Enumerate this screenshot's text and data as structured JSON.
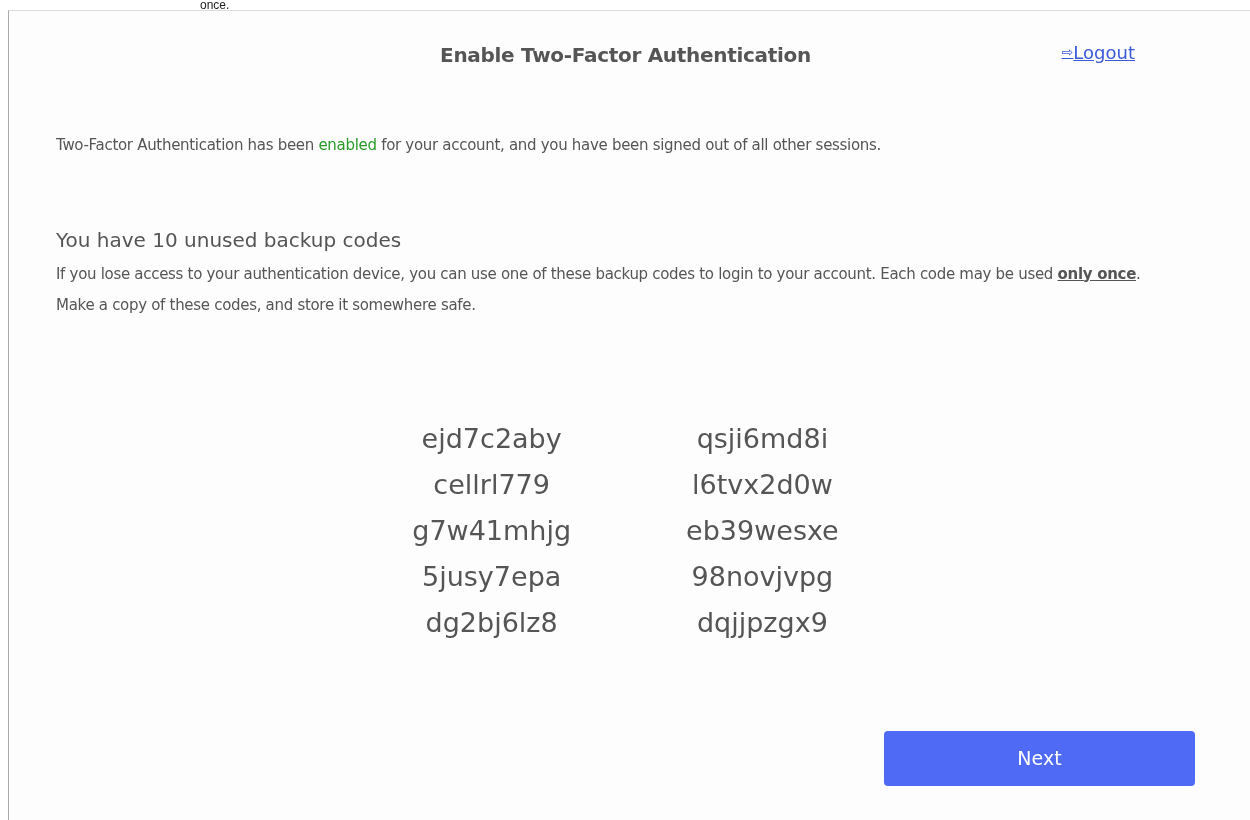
{
  "top_fragment": "once.",
  "title": "Enable Two-Factor Authentication",
  "logout": {
    "icon": "⇨",
    "label": "Logout"
  },
  "status_message": [
    {
      "kind": "plain",
      "text": "Two-Factor Authentication has been "
    },
    {
      "kind": "success",
      "text": "enabled"
    },
    {
      "kind": "plain",
      "text": " for your account, and you have been signed out of all other sessions."
    }
  ],
  "codes_heading": "You have 10 unused backup codes",
  "codes_info": [
    {
      "kind": "plain",
      "text": "If you lose access to your authentication device, you can use one of these backup codes to login to your account.  Each code may be used "
    },
    {
      "kind": "strong",
      "text": "only once"
    },
    {
      "kind": "plain",
      "text": ". Make a copy of these codes, and store it somewhere safe."
    }
  ],
  "codes": [
    [
      "ejd7c2aby",
      "cellrl779",
      "g7w41mhjg",
      "5jusy7epa",
      "dg2bj6lz8"
    ],
    [
      "qsji6md8i",
      "l6tvx2d0w",
      "eb39wesxe",
      "98novjvpg",
      "dqjjpzgx9"
    ]
  ],
  "next_button": "Next"
}
